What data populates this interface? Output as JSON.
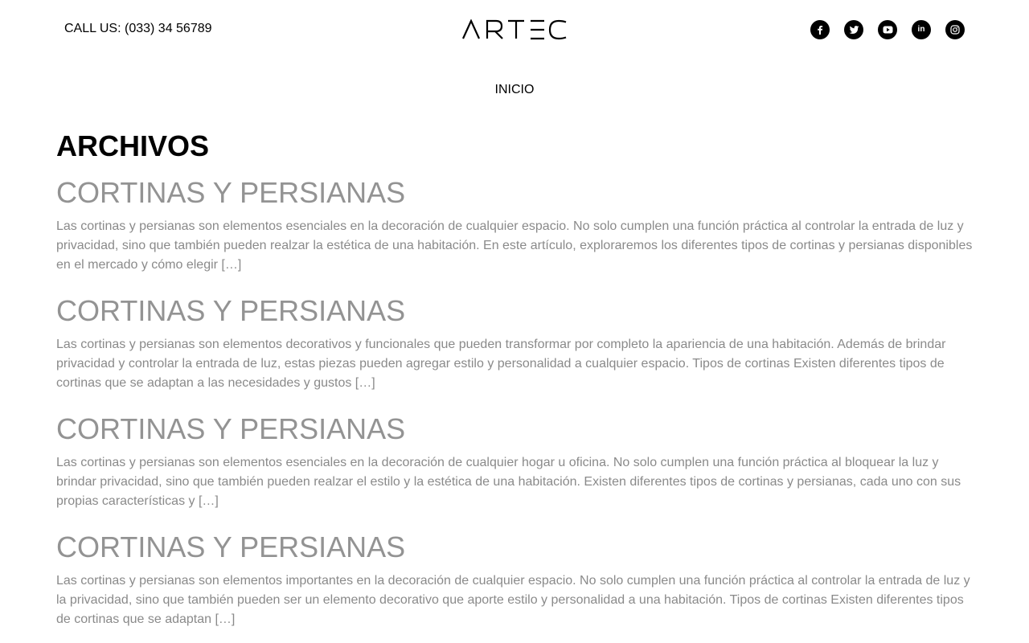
{
  "header": {
    "call_text": "CALL US: (033) 34 56789",
    "logo_text": "ARTEC",
    "socials": [
      {
        "name": "facebook-icon"
      },
      {
        "name": "twitter-icon"
      },
      {
        "name": "youtube-icon"
      },
      {
        "name": "linkedin-icon",
        "label": "in"
      },
      {
        "name": "instagram-icon"
      }
    ]
  },
  "nav": {
    "items": [
      {
        "label": "INICIO"
      }
    ]
  },
  "main": {
    "title": "ARCHIVOS",
    "posts": [
      {
        "title": "CORTINAS Y PERSIANAS",
        "excerpt": "Las cortinas y persianas son elementos esenciales en la decoración de cualquier espacio. No solo cumplen una función práctica al controlar la entrada de luz y privacidad, sino que también pueden realzar la estética de una habitación. En este artículo, exploraremos los diferentes tipos de cortinas y persianas disponibles en el mercado y cómo elegir […]"
      },
      {
        "title": "CORTINAS Y PERSIANAS",
        "excerpt": "Las cortinas y persianas son elementos decorativos y funcionales que pueden transformar por completo la apariencia de una habitación. Además de brindar privacidad y controlar la entrada de luz, estas piezas pueden agregar estilo y personalidad a cualquier espacio. Tipos de cortinas Existen diferentes tipos de cortinas que se adaptan a las necesidades y gustos […]"
      },
      {
        "title": "CORTINAS Y PERSIANAS",
        "excerpt": "Las cortinas y persianas son elementos esenciales en la decoración de cualquier hogar u oficina. No solo cumplen una función práctica al bloquear la luz y brindar privacidad, sino que también pueden realzar el estilo y la estética de una habitación. Existen diferentes tipos de cortinas y persianas, cada uno con sus propias características y […]"
      },
      {
        "title": "CORTINAS Y PERSIANAS",
        "excerpt": "Las cortinas y persianas son elementos importantes en la decoración de cualquier espacio. No solo cumplen una función práctica al controlar la entrada de luz y la privacidad, sino que también pueden ser un elemento decorativo que aporte estilo y personalidad a una habitación. Tipos de cortinas Existen diferentes tipos de cortinas que se adaptan […]"
      }
    ]
  },
  "colors": {
    "text": "#000000",
    "post_title": "#939393",
    "excerpt": "#8a8a8a",
    "background": "#ffffff"
  }
}
